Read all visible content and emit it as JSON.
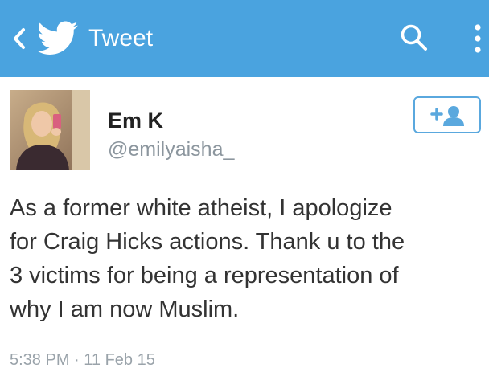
{
  "header": {
    "title": "Tweet",
    "bar_color": "#4aa3df",
    "back_icon": "chevron-left-icon",
    "logo_icon": "twitter-bird-icon",
    "search_icon": "search-icon",
    "menu_icon": "overflow-menu-icon"
  },
  "tweet": {
    "author_name": "Em K",
    "handle": "@emilyaisha_",
    "follow_icon": "add-person-icon",
    "text": "As a former white atheist, I apologize\nfor Craig Hicks actions. Thank u to the\n3 victims for being a representation of\nwhy I am now Muslim.",
    "timestamp": "5:38 PM · 11 Feb 15"
  }
}
